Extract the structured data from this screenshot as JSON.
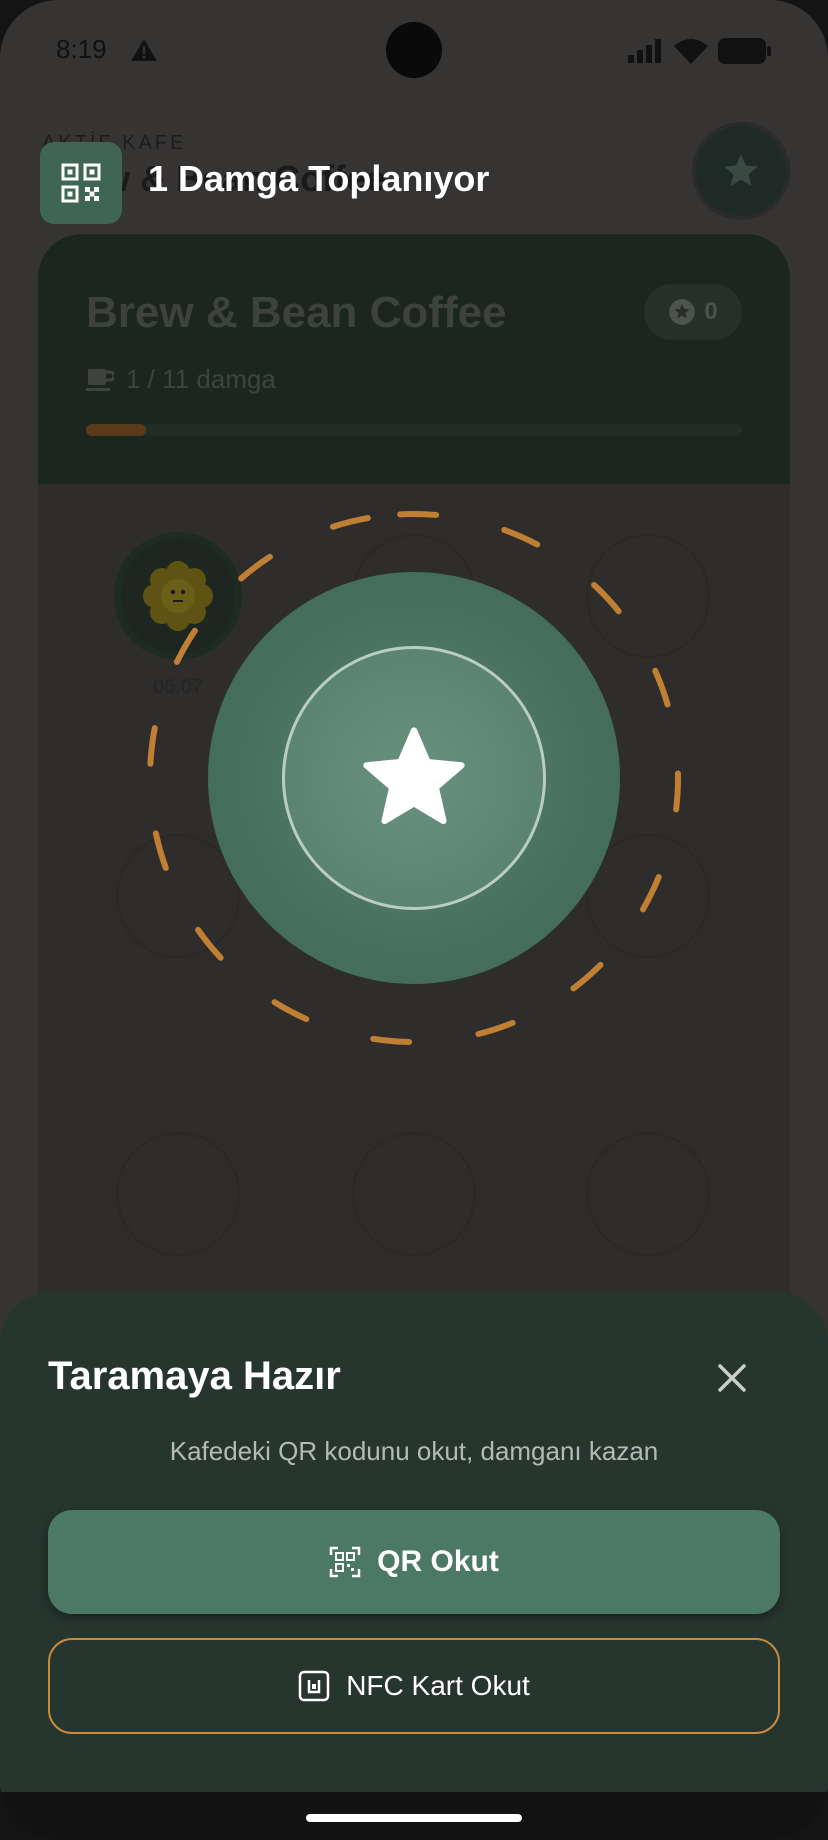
{
  "status_bar": {
    "time": "8:19",
    "icons": [
      "warning-icon",
      "signal-icon",
      "wifi-icon",
      "battery-icon"
    ]
  },
  "header": {
    "overline": "AKTİF KAFE",
    "cafe_name": "Brew & Bean Coffee",
    "toast": "1 Damga Toplanıyor",
    "qr_icon": "qr-code-icon",
    "star_button_icon": "star-icon"
  },
  "card": {
    "title": "Brew & Bean Coffee",
    "points": "0",
    "stamp_progress_text": "1 / 11 damga",
    "progress_fraction": 0.0909,
    "stamp_date": "06.07"
  },
  "sheet": {
    "title": "Taramaya Hazır",
    "subtitle": "Kafedeki QR kodunu okut, damganı kazan",
    "qr_button": "QR Okut",
    "nfc_button": "NFC Kart Okut"
  },
  "colors": {
    "accent_green": "#4c7866",
    "accent_orange": "#c98a3a",
    "sheet_bg": "#27352f"
  }
}
